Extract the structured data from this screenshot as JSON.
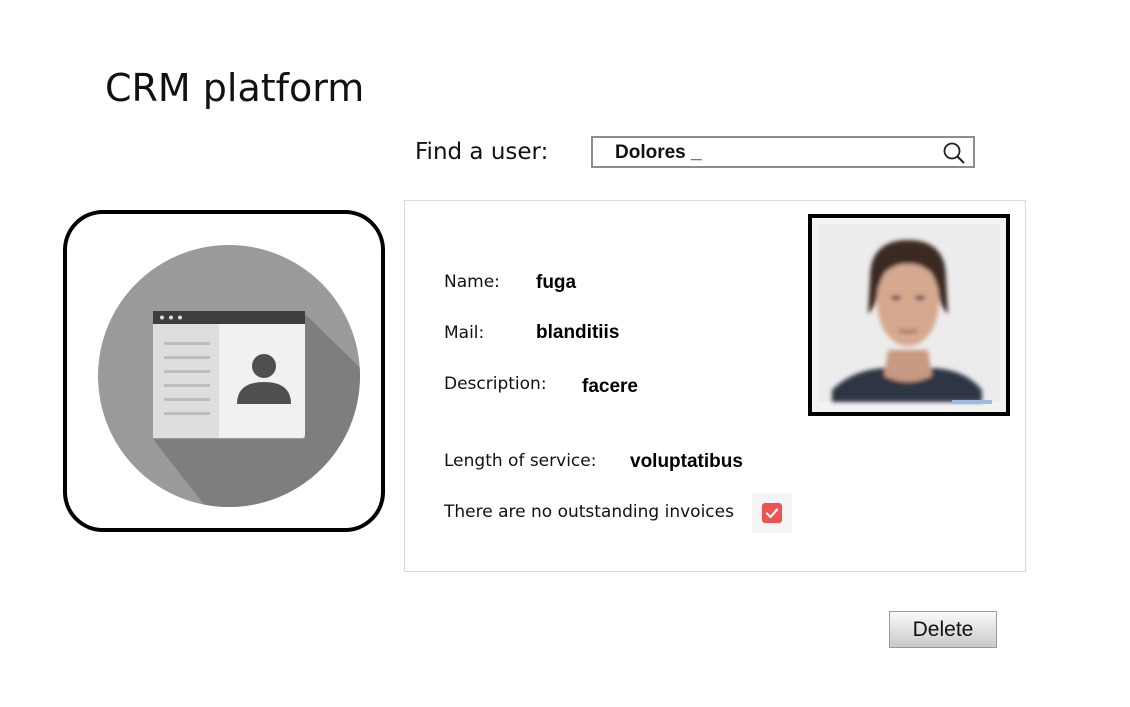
{
  "app": {
    "title": "CRM platform"
  },
  "search": {
    "label": "Find a user:",
    "value": "Dolores _",
    "icon": "search-icon"
  },
  "profile": {
    "name_label": "Name:",
    "name_value": "fuga",
    "mail_label": "Mail:",
    "mail_value": "blanditiis",
    "description_label": "Description:",
    "description_value": "facere",
    "service_label": "Length of service:",
    "service_value": "voluptatibus",
    "invoices_label": "There are no outstanding invoices",
    "invoices_checked": true
  },
  "actions": {
    "delete_label": "Delete"
  },
  "colors": {
    "checkbox": "#ee5353",
    "icon_circle": "#9a9a9a",
    "border": "#000000"
  }
}
